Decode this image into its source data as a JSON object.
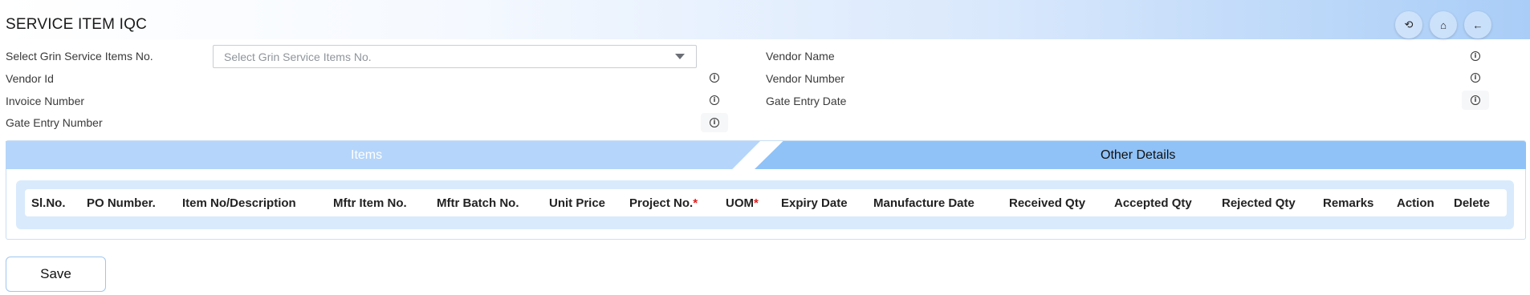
{
  "header": {
    "title": "SERVICE ITEM IQC",
    "icons": [
      "history-icon",
      "home-icon",
      "back-arrow-icon"
    ],
    "glyphs": {
      "history": "⟲",
      "home": "⌂",
      "back": "←"
    }
  },
  "form": {
    "grin_label": "Select Grin Service Items No.",
    "grin_placeholder": "Select Grin Service Items No.",
    "vendor_id_label": "Vendor Id",
    "invoice_number_label": "Invoice Number",
    "gate_entry_number_label": "Gate Entry Number",
    "vendor_name_label": "Vendor Name",
    "vendor_number_label": "Vendor Number",
    "gate_entry_date_label": "Gate Entry Date",
    "info_glyph": "i"
  },
  "tabs": {
    "items": "Items",
    "other_details": "Other Details",
    "active": "items"
  },
  "table": {
    "columns": [
      {
        "label": "Sl.No."
      },
      {
        "label": "PO Number."
      },
      {
        "label": "Item No/Description"
      },
      {
        "label": "Mftr Item No."
      },
      {
        "label": "Mftr Batch No."
      },
      {
        "label": "Unit Price"
      },
      {
        "label": "Project No.",
        "required": true
      },
      {
        "label": "UOM",
        "required": true
      },
      {
        "label": "Expiry Date"
      },
      {
        "label": "Manufacture Date"
      },
      {
        "label": "Received Qty"
      },
      {
        "label": "Accepted Qty"
      },
      {
        "label": "Rejected Qty"
      },
      {
        "label": "Remarks"
      },
      {
        "label": "Action"
      },
      {
        "label": "Delete"
      }
    ],
    "required_mark": "*"
  },
  "actions": {
    "save_label": "Save"
  },
  "colors": {
    "tab_active": "#b5d5fa",
    "tab_inactive": "#90c2f7",
    "table_bg": "#d9eafd",
    "required": "#e11d1d"
  }
}
